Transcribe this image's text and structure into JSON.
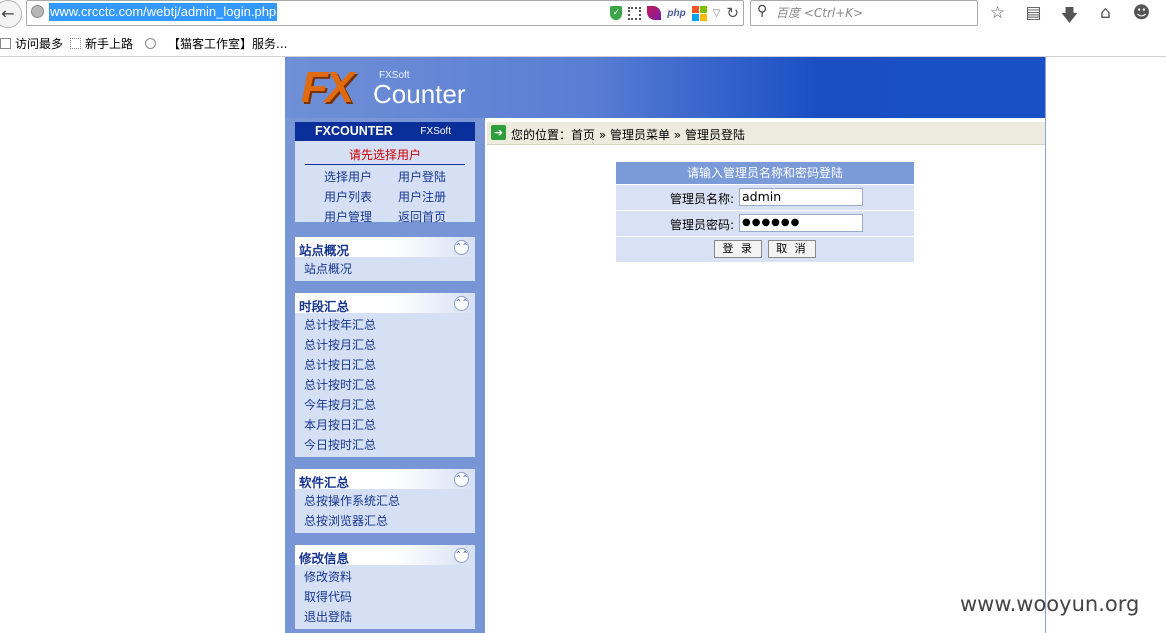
{
  "browser": {
    "url": "www.crcctc.com/webtj/admin_login.php",
    "search_placeholder": "百度 <Ctrl+K>",
    "php_label": "php",
    "bookmarks": [
      "访问最多",
      "新手上路",
      "【猫客工作室】服务..."
    ]
  },
  "logo": {
    "fx": "FX",
    "fxsoft": "FXSoft",
    "counter": "Counter"
  },
  "userbox": {
    "title": "FXCOUNTER",
    "subtitle": "FXSoft",
    "warning": "请先选择用户",
    "links": [
      "选择用户",
      "用户登陆",
      "用户列表",
      "用户注册",
      "用户管理",
      "返回首页"
    ]
  },
  "groups": [
    {
      "title": "站点概况",
      "items": [
        "站点概况"
      ]
    },
    {
      "title": "时段汇总",
      "items": [
        "总计按年汇总",
        "总计按月汇总",
        "总计按日汇总",
        "总计按时汇总",
        "今年按月汇总",
        "本月按日汇总",
        "今日按时汇总"
      ]
    },
    {
      "title": "软件汇总",
      "items": [
        "总按操作系统汇总",
        "总按浏览器汇总"
      ]
    },
    {
      "title": "修改信息",
      "items": [
        "修改资料",
        "取得代码",
        "退出登陆"
      ]
    }
  ],
  "breadcrumb": "您的位置：首页 » 管理员菜单 » 管理员登陆",
  "login": {
    "header": "请输入管理员名称和密码登陆",
    "username_label": "管理员名称:",
    "username_value": "admin",
    "password_label": "管理员密码:",
    "password_value": "●●●●●●",
    "login_button": "登 录",
    "cancel_button": "取 消"
  },
  "watermark": "www.wooyun.org"
}
